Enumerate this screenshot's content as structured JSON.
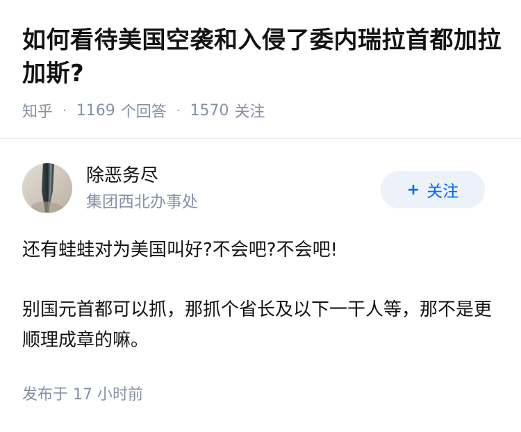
{
  "question": {
    "title": "如何看待美国空袭和入侵了委内瑞拉首都加拉加斯?",
    "meta": {
      "source": "知乎",
      "separator": "·",
      "answer_count": "1169",
      "answer_label": "个回答",
      "follower_count": "1570",
      "follower_label": "关注"
    }
  },
  "answer": {
    "author": {
      "name": "除恶务尽",
      "bio": "集团西北办事处",
      "avatar_icon": "knife-blade-avatar"
    },
    "follow_button": {
      "icon": "plus-icon",
      "label": "关注"
    },
    "content": {
      "paragraphs": [
        "还有蛙蛙对为美国叫好?不会吧?不会吧!",
        "别国元首都可以抓，那抓个省长及以下一干人等，那不是更顺理成章的嘛。"
      ]
    },
    "published": "发布于 17 小时前"
  },
  "colors": {
    "primary_text": "#121212",
    "secondary_text": "#8590a6",
    "brand_blue": "#0066ff",
    "follow_button_bg": "#ebf2fa",
    "divider": "#ebebeb"
  }
}
